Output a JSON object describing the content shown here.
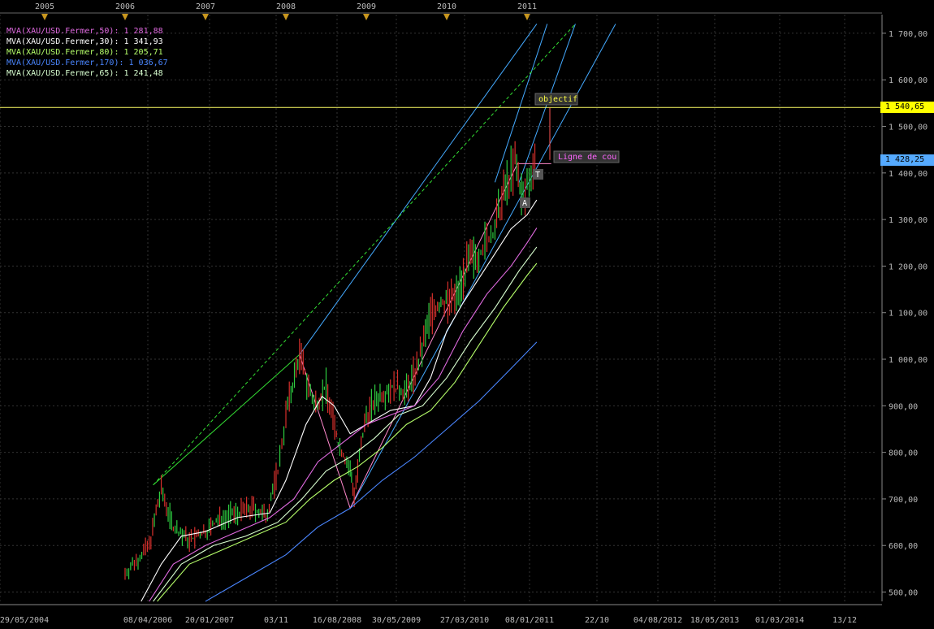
{
  "legend": [
    {
      "label": "MVA(XAU/USD.Fermer,50): 1 281,88",
      "color": "#e06ae0"
    },
    {
      "label": "MVA(XAU/USD.Fermer,30): 1 341,93",
      "color": "#ffffff"
    },
    {
      "label": "MVA(XAU/USD.Fermer,80): 1 205,71",
      "color": "#b6ff6a"
    },
    {
      "label": "MVA(XAU/USD.Fermer,170): 1 036,67",
      "color": "#4a86ff"
    },
    {
      "label": "MVA(XAU/USD.Fermer,65): 1 241,48",
      "color": "#d8ffd0"
    }
  ],
  "price_tags": [
    {
      "label": "1 540,65",
      "value": 1540.65,
      "bg": "#ffff00"
    },
    {
      "label": "1 428,25",
      "value": 1428.25,
      "bg": "#55aaff"
    }
  ],
  "annotations": {
    "objectif": "objectif",
    "ligne": "Ligne de cou",
    "t": "T",
    "a": "A"
  },
  "chart_data": {
    "type": "line",
    "title": "",
    "ylim": [
      480,
      1740
    ],
    "y_ticks": [
      {
        "label": "500,00",
        "value": 500
      },
      {
        "label": "600,00",
        "value": 600
      },
      {
        "label": "700,00",
        "value": 700
      },
      {
        "label": "800,00",
        "value": 800
      },
      {
        "label": "900,00",
        "value": 900
      },
      {
        "label": "1 000,00",
        "value": 1000
      },
      {
        "label": "1 100,00",
        "value": 1100
      },
      {
        "label": "1 200,00",
        "value": 1200
      },
      {
        "label": "1 300,00",
        "value": 1300
      },
      {
        "label": "1 400,00",
        "value": 1400
      },
      {
        "label": "1 500,00",
        "value": 1500
      },
      {
        "label": "1 600,00",
        "value": 1600
      },
      {
        "label": "1 700,00",
        "value": 1700
      }
    ],
    "x_ticks": [
      "29/05/2004",
      "08/04/2006",
      "20/01/2007",
      "03/11",
      "16/08/2008",
      "30/05/2009",
      "27/03/2010",
      "08/01/2011",
      "22/10",
      "04/08/2012",
      "18/05/2013",
      "01/03/2014",
      "13/12"
    ],
    "year_markers": [
      "2005",
      "2006",
      "2007",
      "2008",
      "2009",
      "2010",
      "2011"
    ],
    "horizontal_lines": [
      {
        "value": 1540.65,
        "color": "#ffff66"
      }
    ],
    "price_series": {
      "name": "XAU/USD",
      "x": [
        2006.0,
        2006.3,
        2006.45,
        2006.6,
        2006.8,
        2007.0,
        2007.2,
        2007.4,
        2007.6,
        2007.75,
        2007.9,
        2008.0,
        2008.17,
        2008.35,
        2008.5,
        2008.65,
        2008.8,
        2008.85,
        2009.0,
        2009.15,
        2009.3,
        2009.5,
        2009.65,
        2009.8,
        2009.95,
        2010.1,
        2010.25,
        2010.4,
        2010.5,
        2010.6,
        2010.75,
        2010.85,
        2010.95,
        2011.05,
        2011.12
      ],
      "y": [
        540,
        600,
        720,
        640,
        610,
        630,
        660,
        670,
        680,
        660,
        760,
        880,
        1010,
        900,
        940,
        820,
        760,
        710,
        880,
        920,
        940,
        930,
        990,
        1100,
        1120,
        1130,
        1200,
        1230,
        1250,
        1280,
        1380,
        1420,
        1340,
        1410,
        1430
      ]
    },
    "series": [
      {
        "color": "#ffffff",
        "x": [
          2006.2,
          2006.45,
          2006.7,
          2007.0,
          2007.4,
          2007.8,
          2008.0,
          2008.25,
          2008.45,
          2008.6,
          2008.8,
          2009.0,
          2009.3,
          2009.6,
          2009.8,
          2010.0,
          2010.2,
          2010.5,
          2010.8,
          2011.0,
          2011.12
        ],
        "y": [
          480,
          560,
          620,
          630,
          660,
          670,
          740,
          860,
          920,
          900,
          840,
          860,
          890,
          900,
          960,
          1060,
          1120,
          1200,
          1280,
          1310,
          1342
        ]
      },
      {
        "color": "#e06ae0",
        "x": [
          2006.3,
          2006.6,
          2007.0,
          2007.4,
          2007.8,
          2008.1,
          2008.4,
          2008.7,
          2009.0,
          2009.3,
          2009.6,
          2009.9,
          2010.2,
          2010.5,
          2010.8,
          2011.0,
          2011.12
        ],
        "y": [
          480,
          560,
          600,
          630,
          660,
          700,
          780,
          820,
          860,
          880,
          900,
          960,
          1060,
          1140,
          1200,
          1250,
          1282
        ]
      },
      {
        "color": "#d8ffd0",
        "x": [
          2006.35,
          2006.7,
          2007.1,
          2007.5,
          2007.9,
          2008.2,
          2008.5,
          2008.8,
          2009.1,
          2009.4,
          2009.7,
          2010.0,
          2010.3,
          2010.6,
          2010.9,
          2011.12
        ],
        "y": [
          480,
          560,
          600,
          620,
          650,
          700,
          760,
          790,
          830,
          880,
          900,
          960,
          1040,
          1110,
          1190,
          1241
        ]
      },
      {
        "color": "#b6ff6a",
        "x": [
          2006.4,
          2006.8,
          2007.2,
          2007.6,
          2008.0,
          2008.3,
          2008.6,
          2008.9,
          2009.2,
          2009.5,
          2009.8,
          2010.1,
          2010.4,
          2010.7,
          2011.0,
          2011.12
        ],
        "y": [
          480,
          560,
          590,
          620,
          650,
          700,
          740,
          770,
          810,
          860,
          890,
          950,
          1030,
          1110,
          1180,
          1206
        ]
      },
      {
        "color": "#4a86ff",
        "x": [
          2007.0,
          2007.5,
          2008.0,
          2008.4,
          2008.8,
          2009.2,
          2009.6,
          2010.0,
          2010.4,
          2010.8,
          2011.12
        ],
        "y": [
          480,
          530,
          580,
          640,
          680,
          740,
          790,
          850,
          910,
          980,
          1037
        ]
      }
    ],
    "trend_lines": [
      {
        "color": "#44aaff",
        "dash": false,
        "x": [
          2008.17,
          2011.12
        ],
        "y": [
          1010,
          1720
        ]
      },
      {
        "color": "#44aaff",
        "dash": false,
        "x": [
          2008.8,
          2012.1
        ],
        "y": [
          680,
          1720
        ]
      },
      {
        "color": "#44aaff",
        "dash": false,
        "x": [
          2010.6,
          2011.25
        ],
        "y": [
          1380,
          1720
        ]
      },
      {
        "color": "#44aaff",
        "dash": false,
        "x": [
          2010.9,
          2011.6
        ],
        "y": [
          1380,
          1720
        ]
      },
      {
        "color": "#33dd33",
        "dash": true,
        "x": [
          2006.35,
          2011.6
        ],
        "y": [
          730,
          1720
        ]
      },
      {
        "color": "#33dd33",
        "dash": false,
        "x": [
          2006.35,
          2008.17
        ],
        "y": [
          730,
          1010
        ]
      },
      {
        "color": "#ff88cc",
        "dash": false,
        "x": [
          2008.17,
          2008.8,
          2008.8,
          2010.88,
          2011.3
        ],
        "y": [
          1010,
          680,
          680,
          1420,
          1420
        ]
      }
    ]
  }
}
